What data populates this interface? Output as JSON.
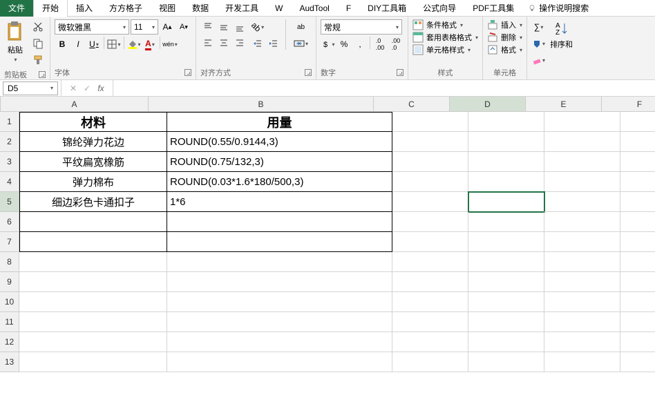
{
  "menu": {
    "file": "文件",
    "home": "开始",
    "insert": "插入",
    "ffgz": "方方格子",
    "view": "视图",
    "data": "数据",
    "dev": "开发工具",
    "w": "W",
    "audtool": "AudTool",
    "f": "F",
    "diy": "DIY工具箱",
    "fxguide": "公式向导",
    "pdf": "PDF工具集",
    "help": "操作说明搜索"
  },
  "ribbon": {
    "clipboard": {
      "label": "剪贴板",
      "paste": "粘贴"
    },
    "font": {
      "label": "字体",
      "name": "微软雅黑",
      "size": "11",
      "bold": "B",
      "italic": "I",
      "underline": "U",
      "wen": "wén"
    },
    "alignment": {
      "label": "对齐方式",
      "wrap": "ab"
    },
    "number": {
      "label": "数字",
      "format": "常规"
    },
    "styles": {
      "label": "样式",
      "cond": "条件格式",
      "table": "套用表格格式",
      "cell": "单元格样式"
    },
    "cells": {
      "label": "单元格",
      "insert": "插入",
      "delete": "删除",
      "format": "格式"
    },
    "editing": {
      "sort": "排序和"
    }
  },
  "formulaBar": {
    "nameBox": "D5",
    "value": ""
  },
  "columns": [
    "A",
    "B",
    "C",
    "D",
    "E",
    "F"
  ],
  "rows": [
    "1",
    "2",
    "3",
    "4",
    "5",
    "6",
    "7",
    "8",
    "9",
    "10",
    "11",
    "12",
    "13"
  ],
  "table": {
    "header": {
      "a": "材料",
      "b": "用量"
    },
    "data": [
      {
        "a": "锦纶弹力花边",
        "b": "ROUND(0.55/0.9144,3)"
      },
      {
        "a": "平纹扁宽橡筋",
        "b": "ROUND(0.75/132,3)"
      },
      {
        "a": "弹力棉布",
        "b": "ROUND(0.03*1.6*180/500,3)"
      },
      {
        "a": "细边彩色卡通扣子",
        "b": "1*6"
      }
    ]
  },
  "selected": {
    "cell": "D5",
    "row": 5,
    "col": "D"
  }
}
